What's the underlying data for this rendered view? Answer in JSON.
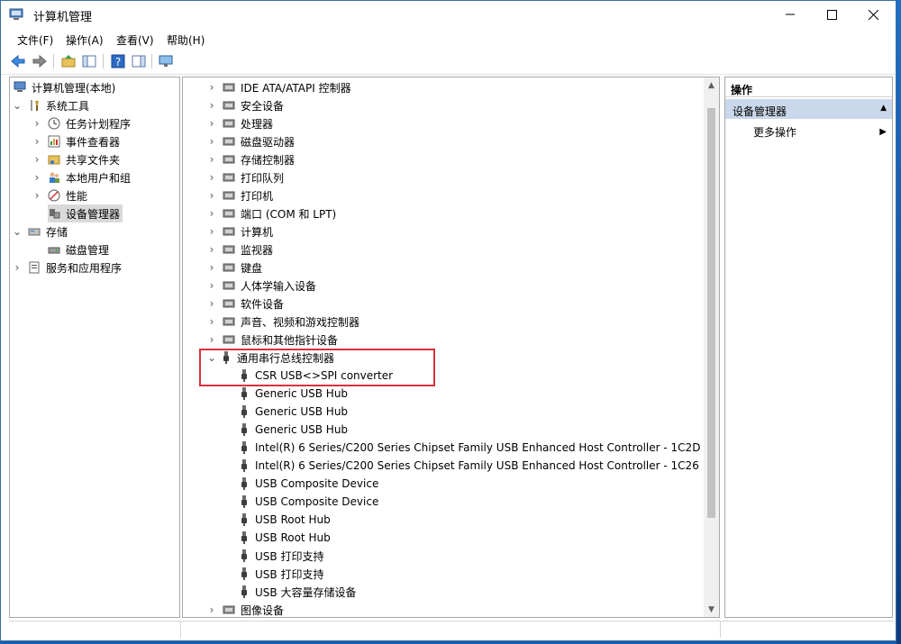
{
  "window": {
    "title": "计算机管理"
  },
  "menu": [
    "文件(F)",
    "操作(A)",
    "查看(V)",
    "帮助(H)"
  ],
  "tree": {
    "root": "计算机管理(本地)",
    "system_tools": "系统工具",
    "task_scheduler": "任务计划程序",
    "event_viewer": "事件查看器",
    "shared_folders": "共享文件夹",
    "local_users": "本地用户和组",
    "performance": "性能",
    "device_manager": "设备管理器",
    "storage": "存储",
    "disk_management": "磁盘管理",
    "services_apps": "服务和应用程序"
  },
  "devices": {
    "categories_top": [
      "IDE ATA/ATAPI 控制器",
      "安全设备",
      "处理器",
      "磁盘驱动器",
      "存储控制器",
      "打印队列",
      "打印机",
      "端口 (COM 和 LPT)",
      "计算机",
      "监视器",
      "键盘",
      "人体学输入设备",
      "软件设备",
      "声音、视频和游戏控制器",
      "鼠标和其他指针设备"
    ],
    "usb_category": "通用串行总线控制器",
    "usb_children": [
      "CSR USB<>SPI converter",
      "Generic USB Hub",
      "Generic USB Hub",
      "Generic USB Hub",
      "Intel(R) 6 Series/C200 Series Chipset Family USB Enhanced Host Controller - 1C2D",
      "Intel(R) 6 Series/C200 Series Chipset Family USB Enhanced Host Controller - 1C26",
      "USB Composite Device",
      "USB Composite Device",
      "USB Root Hub",
      "USB Root Hub",
      "USB 打印支持",
      "USB 打印支持",
      "USB 大容量存储设备"
    ],
    "last_category": "图像设备"
  },
  "actions": {
    "header": "操作",
    "section": "设备管理器",
    "more": "更多操作"
  },
  "colors": {
    "highlight": "#d9313b",
    "accent": "#c9d8ea"
  }
}
